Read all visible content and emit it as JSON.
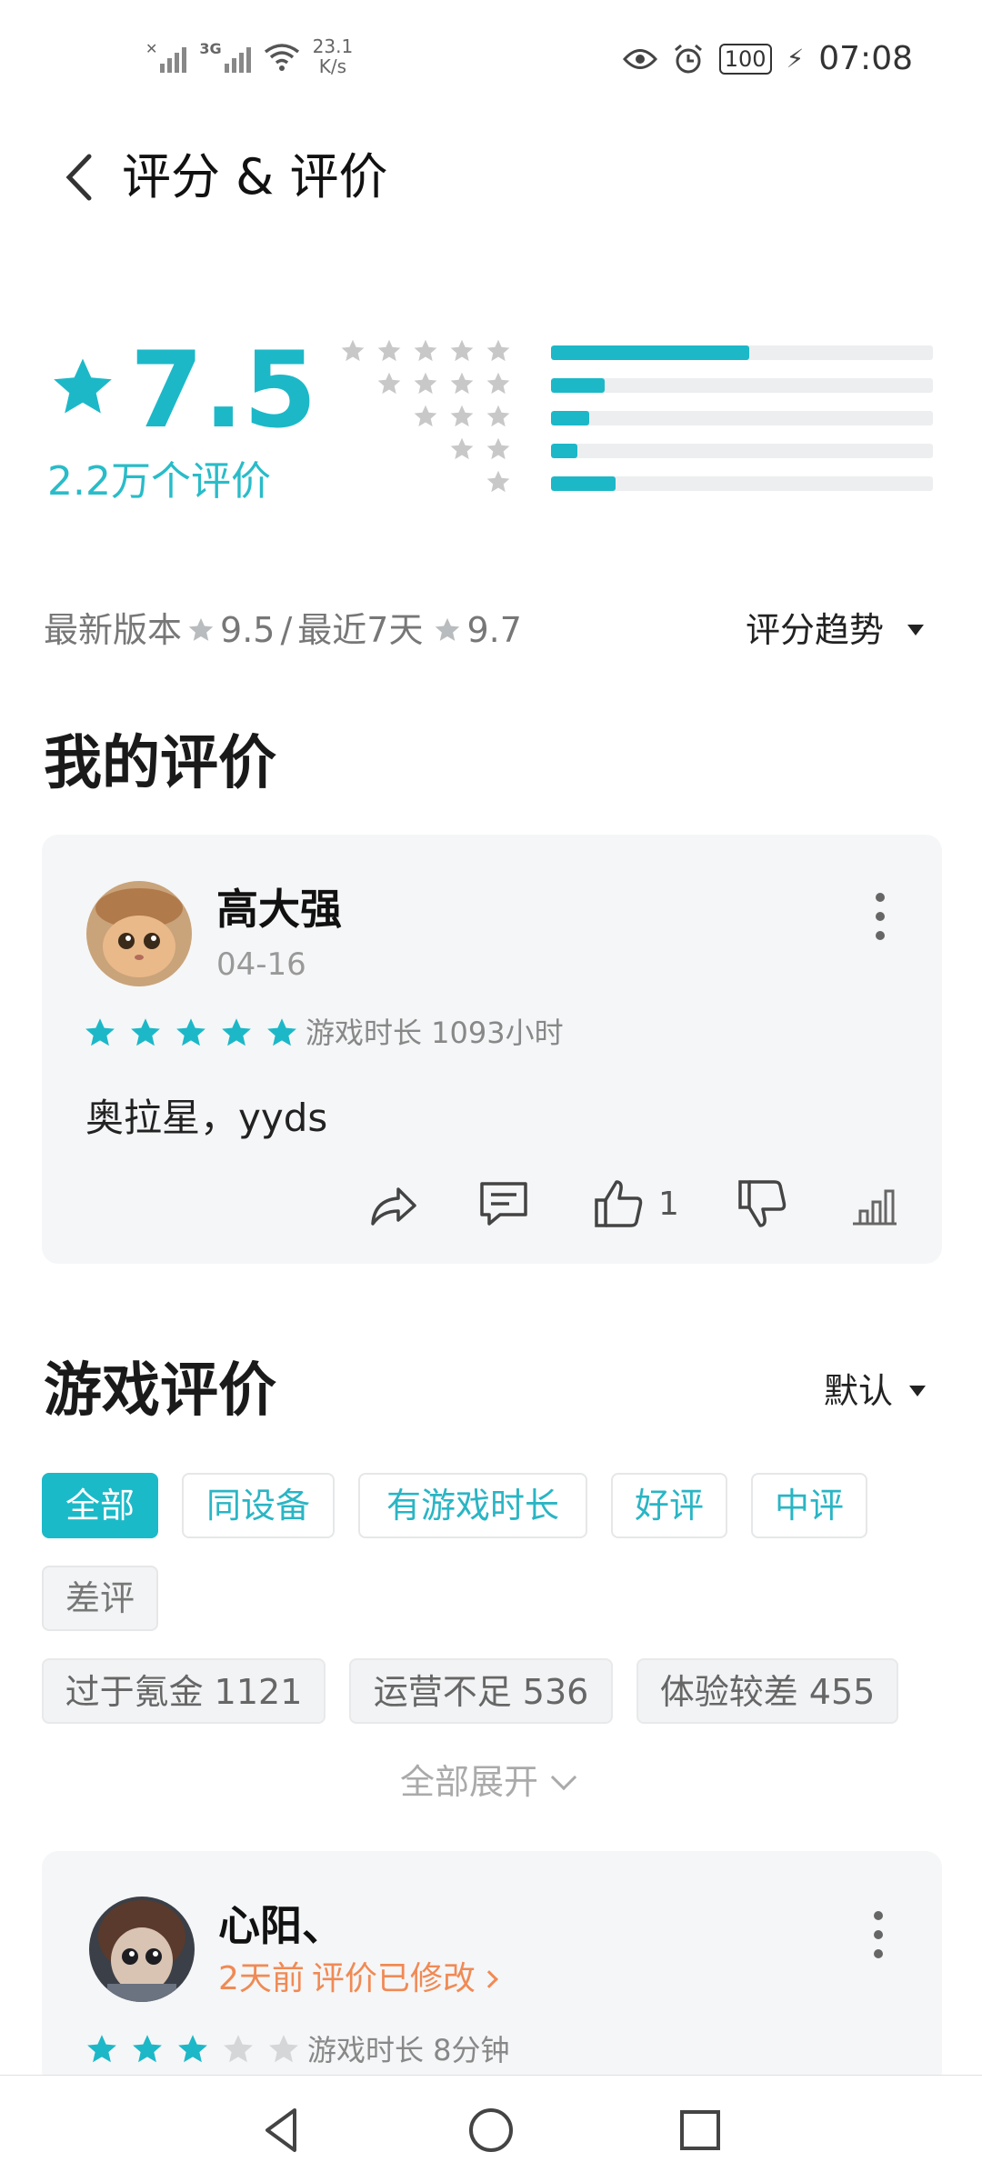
{
  "status_bar": {
    "network_type": "3G",
    "net_speed_value": "23.1",
    "net_speed_unit": "K/s",
    "battery": "100",
    "time": "07:08"
  },
  "header": {
    "title": "评分 & 评价",
    "back_icon": "chevron-left-icon"
  },
  "rating": {
    "score": "7.5",
    "count_label": "2.2万个评价",
    "distribution": [
      {
        "stars": 5,
        "fraction": 0.52
      },
      {
        "stars": 4,
        "fraction": 0.14
      },
      {
        "stars": 3,
        "fraction": 0.1
      },
      {
        "stars": 2,
        "fraction": 0.07
      },
      {
        "stars": 1,
        "fraction": 0.17
      }
    ],
    "version_label": "最新版本",
    "version_score": "9.5",
    "separator": "/",
    "recent_label": "最近7天",
    "recent_score": "9.7",
    "trend_label": "评分趋势"
  },
  "my_review": {
    "section_title": "我的评价",
    "user": "高大强",
    "date": "04-16",
    "stars": 5,
    "playtime": "游戏时长 1093小时",
    "text": "奥拉星，yyds",
    "like_count": "1"
  },
  "game_reviews": {
    "section_title": "游戏评价",
    "sort_label": "默认",
    "filters": [
      "全部",
      "同设备",
      "有游戏时长",
      "好评",
      "中评",
      "差评"
    ],
    "tags": [
      "过于氪金 1121",
      "运营不足 536",
      "体验较差 455"
    ],
    "expand_label": "全部展开",
    "items": [
      {
        "user": "心阳、",
        "time_ago": "2天前",
        "edited_label": "评价已修改",
        "stars": 3,
        "playtime": "游戏时长 8分钟"
      }
    ]
  },
  "colors": {
    "accent": "#1cb8c8",
    "star_gray": "#c8c8c8",
    "edited": "#f08a54"
  }
}
